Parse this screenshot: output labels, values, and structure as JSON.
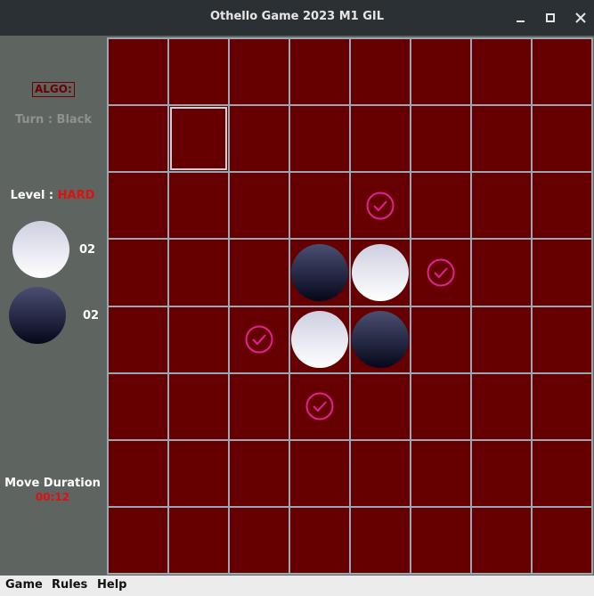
{
  "window": {
    "title": "Othello Game 2023 M1 GIL",
    "controls": [
      "minimize-icon",
      "maximize-icon",
      "close-icon"
    ]
  },
  "sidebar": {
    "algo_label": "ALGO:",
    "turn_text": "Turn : Black",
    "level_label": "Level : ",
    "level_value": "HARD",
    "white_count": "02",
    "black_count": "02",
    "move_duration_label": "Move Duration",
    "move_duration_value": "00:12"
  },
  "board": {
    "size": 8,
    "selected": [
      1,
      1
    ],
    "cells": [
      "........",
      "........",
      "....h...",
      "....BWh.",
      "...hWB..",
      ".....h..",
      "........",
      "........"
    ],
    "legend": {
      "B": "white disc",
      "W": "white disc",
      "h": "valid move hint"
    },
    "discs": [
      {
        "row": 3,
        "col": 3,
        "color": "black"
      },
      {
        "row": 3,
        "col": 4,
        "color": "white"
      },
      {
        "row": 4,
        "col": 3,
        "color": "white"
      },
      {
        "row": 4,
        "col": 4,
        "color": "black"
      }
    ],
    "hints": [
      {
        "row": 2,
        "col": 4
      },
      {
        "row": 3,
        "col": 5
      },
      {
        "row": 4,
        "col": 2
      },
      {
        "row": 5,
        "col": 3
      }
    ]
  },
  "menu": [
    "Game",
    "Rules",
    "Help"
  ],
  "colors": {
    "board": "#660000",
    "grid": "#9aa6b2",
    "hint": "#e0219a",
    "sidebar": "#5e6460",
    "accent_red": "#e01010"
  }
}
